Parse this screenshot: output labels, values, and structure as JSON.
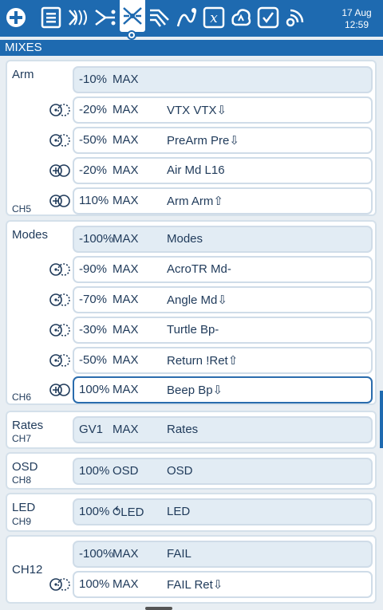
{
  "status": {
    "date": "17 Aug",
    "time": "12:59"
  },
  "topbar": {
    "icons": [
      "menu-plus-icon",
      "model-list-icon",
      "flight-modes-icon",
      "inputs-icon",
      "mixes-icon",
      "outputs-icon",
      "curves-icon",
      "global-variables-icon",
      "logical-switches-icon",
      "special-functions-icon",
      "telemetry-icon"
    ]
  },
  "page": {
    "title": "MIXES"
  },
  "groups": [
    {
      "name": "Arm",
      "channel": "CH5",
      "rows": [
        {
          "weight": "-10%",
          "source": "MAX",
          "name": "",
          "mplex": ""
        },
        {
          "weight": "-20%",
          "source": "MAX",
          "name": "VTX VTX⇩",
          "mplex": "replace"
        },
        {
          "weight": "-50%",
          "source": "MAX",
          "name": "PreArm Pre⇩",
          "mplex": "replace"
        },
        {
          "weight": "-20%",
          "source": "MAX",
          "name": "Air Md L16",
          "mplex": "add"
        },
        {
          "weight": "110%",
          "source": "MAX",
          "name": "Arm Arm⇧",
          "mplex": "add"
        }
      ]
    },
    {
      "name": "Modes",
      "channel": "CH6",
      "rows": [
        {
          "weight": "-100%",
          "source": "MAX",
          "name": "Modes",
          "mplex": ""
        },
        {
          "weight": "-90%",
          "source": "MAX",
          "name": "AcroTR Md-",
          "mplex": "replace"
        },
        {
          "weight": "-70%",
          "source": "MAX",
          "name": "Angle Md⇩",
          "mplex": "replace"
        },
        {
          "weight": "-30%",
          "source": "MAX",
          "name": "Turtle Bp-",
          "mplex": "replace"
        },
        {
          "weight": "-50%",
          "source": "MAX",
          "name": "Return !Ret⇧",
          "mplex": "replace"
        },
        {
          "weight": "100%",
          "source": "MAX",
          "name": "Beep Bp⇩",
          "mplex": "add"
        }
      ]
    },
    {
      "name": "Rates",
      "channel": "CH7",
      "rows": [
        {
          "weight": "GV1",
          "source": "MAX",
          "name": "Rates",
          "mplex": ""
        }
      ]
    },
    {
      "name": "OSD",
      "channel": "CH8",
      "rows": [
        {
          "weight": "100%",
          "source": "OSD",
          "name": "OSD",
          "mplex": ""
        }
      ]
    },
    {
      "name": "LED",
      "channel": "CH9",
      "rows": [
        {
          "weight": "100%",
          "source": "⥀LED",
          "name": "LED",
          "mplex": ""
        }
      ]
    },
    {
      "name": "CH12",
      "channel": "",
      "rows": [
        {
          "weight": "-100%",
          "source": "MAX",
          "name": "FAIL",
          "mplex": ""
        },
        {
          "weight": "100%",
          "source": "MAX",
          "name": "FAIL Ret⇩",
          "mplex": "replace"
        }
      ]
    }
  ]
}
